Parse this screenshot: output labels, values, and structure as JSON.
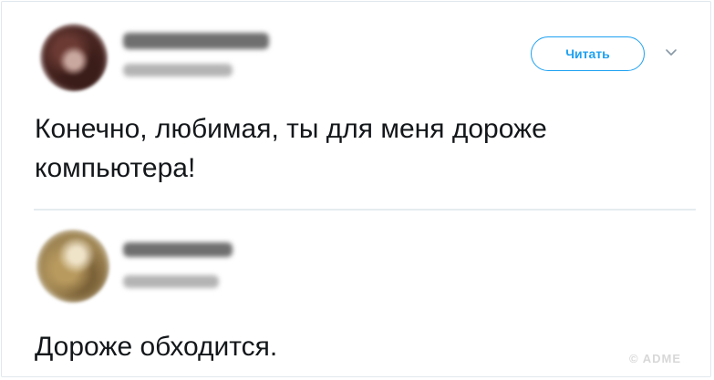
{
  "tweets": [
    {
      "author_name": "",
      "author_handle": "",
      "follow_label": "Читать",
      "text": "Конечно, любимая, ты для меня дороже компьютера!"
    },
    {
      "author_name": "",
      "author_handle": "",
      "text": "Дороже обходится."
    }
  ],
  "icons": {
    "menu": "chevron-down-icon"
  },
  "colors": {
    "accent": "#1da1f2",
    "text": "#14171a",
    "divider": "#e6ecf0"
  },
  "watermark": "© ADME"
}
